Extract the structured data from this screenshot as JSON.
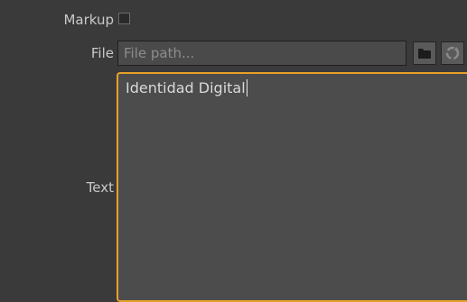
{
  "form": {
    "markup_label": "Markup",
    "markup_checked": false,
    "file_label": "File",
    "file_placeholder": "File path...",
    "file_value": "",
    "text_label": "Text",
    "text_value": "Identidad Digital"
  },
  "icons": {
    "folder": "folder-icon",
    "reload": "reload-icon"
  },
  "colors": {
    "background": "#3a3a3a",
    "focus_border": "#e8a02a",
    "input_bg": "#4a4a4a"
  }
}
